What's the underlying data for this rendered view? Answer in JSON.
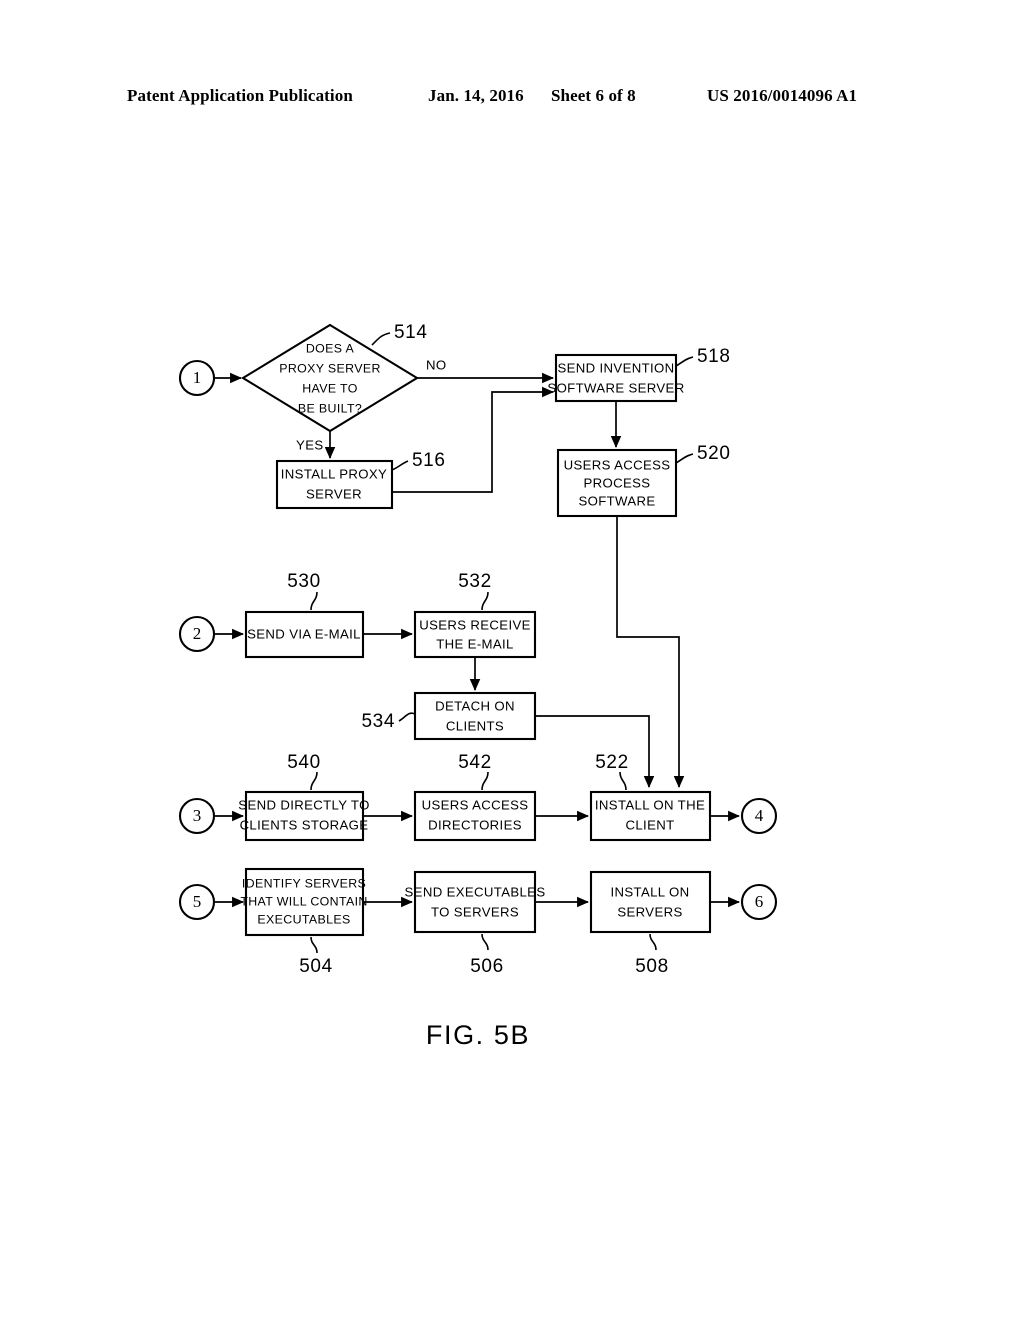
{
  "header": {
    "publication": "Patent Application Publication",
    "date": "Jan. 14, 2016",
    "sheet": "Sheet 6 of 8",
    "patent_number": "US 2016/0014096 A1"
  },
  "figure": {
    "caption": "FIG. 5B"
  },
  "connectors": {
    "in_1": "1",
    "in_2": "2",
    "in_3": "3",
    "out_4": "4",
    "in_5": "5",
    "out_6": "6"
  },
  "branch_labels": {
    "no": "NO",
    "yes": "YES"
  },
  "nodes": {
    "decision_514": {
      "ref": "514",
      "lines": [
        "DOES A",
        "PROXY SERVER",
        "HAVE TO",
        "BE BUILT?"
      ]
    },
    "box_516": {
      "ref": "516",
      "lines": [
        "INSTALL PROXY",
        "SERVER"
      ]
    },
    "box_518": {
      "ref": "518",
      "lines": [
        "SEND INVENTION",
        "SOFTWARE SERVER"
      ]
    },
    "box_520": {
      "ref": "520",
      "lines": [
        "USERS ACCESS",
        "PROCESS",
        "SOFTWARE"
      ]
    },
    "box_530": {
      "ref": "530",
      "lines": [
        "SEND VIA E-MAIL"
      ]
    },
    "box_532": {
      "ref": "532",
      "lines": [
        "USERS RECEIVE",
        "THE E-MAIL"
      ]
    },
    "box_534": {
      "ref": "534",
      "lines": [
        "DETACH ON",
        "CLIENTS"
      ]
    },
    "box_540": {
      "ref": "540",
      "lines": [
        "SEND DIRECTLY TO",
        "CLIENTS STORAGE"
      ]
    },
    "box_542": {
      "ref": "542",
      "lines": [
        "USERS ACCESS",
        "DIRECTORIES"
      ]
    },
    "box_522": {
      "ref": "522",
      "lines": [
        "INSTALL ON THE",
        "CLIENT"
      ]
    },
    "box_504": {
      "ref": "504",
      "lines": [
        "IDENTIFY SERVERS",
        "THAT WILL CONTAIN",
        "EXECUTABLES"
      ]
    },
    "box_506": {
      "ref": "506",
      "lines": [
        "SEND EXECUTABLES",
        "TO SERVERS"
      ]
    },
    "box_508": {
      "ref": "508",
      "lines": [
        "INSTALL ON",
        "SERVERS"
      ]
    }
  }
}
